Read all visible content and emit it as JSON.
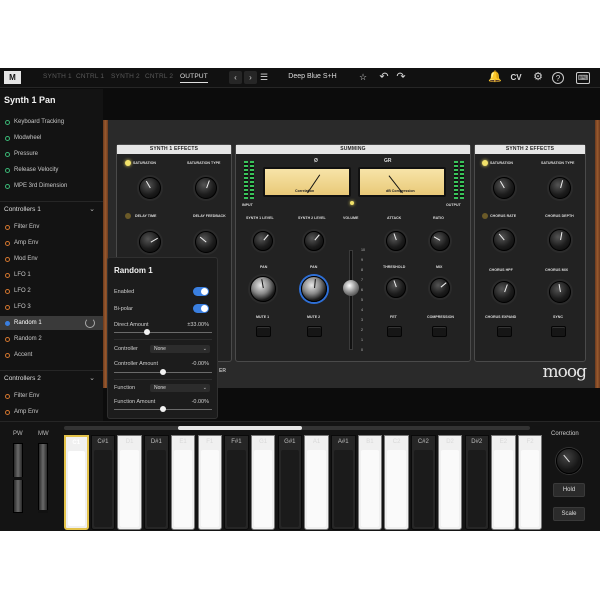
{
  "topbar": {
    "logo": "M",
    "tabs": [
      {
        "label": "SYNTH 1",
        "active": false
      },
      {
        "label": "CNTRL 1",
        "active": false
      },
      {
        "label": "SYNTH 2",
        "active": false
      },
      {
        "label": "CNTRL 2",
        "active": false
      },
      {
        "label": "OUTPUT",
        "active": true
      }
    ],
    "preset_name": "Deep Blue S+H",
    "icons": [
      "chevron-left-icon",
      "chevron-right-icon",
      "list-icon",
      "star-icon",
      "undo-icon",
      "redo-icon",
      "bell-icon",
      "cv-icon",
      "gear-icon",
      "help-icon",
      "keyboard-icon"
    ],
    "cv_label": "CV",
    "help_label": "?"
  },
  "sidebar": {
    "title": "Synth 1 Pan",
    "items": [
      {
        "label": "Keyboard Tracking",
        "color": "green"
      },
      {
        "label": "Modwheel",
        "color": "green"
      },
      {
        "label": "Pressure",
        "color": "green"
      },
      {
        "label": "Release Velocity",
        "color": "green"
      },
      {
        "label": "MPE 3rd Dimension",
        "color": "green"
      }
    ],
    "section1": "Controllers 1",
    "controllers1": [
      {
        "label": "Filter Env"
      },
      {
        "label": "Amp Env"
      },
      {
        "label": "Mod Env"
      },
      {
        "label": "LFO 1"
      },
      {
        "label": "LFO 2"
      },
      {
        "label": "LFO 3"
      },
      {
        "label": "Random 1",
        "active": true
      },
      {
        "label": "Random 2"
      },
      {
        "label": "Accent"
      }
    ],
    "section2": "Controllers 2",
    "controllers2": [
      {
        "label": "Filter Env"
      },
      {
        "label": "Amp Env"
      }
    ]
  },
  "synth": {
    "synth1_effects": {
      "title": "SYNTH 1 EFFECTS",
      "saturation": "SATURATION",
      "saturation_type": "SATURATION TYPE",
      "delay_time": "DELAY TIME",
      "delay_feedback": "DELAY FEEDBACK"
    },
    "summing": {
      "title": "SUMMING",
      "vu_left_label": "Correlation",
      "vu_right_label": "dB Compression",
      "gr_label": "GR",
      "input": "INPUT",
      "output": "OUTPUT",
      "synth1_level": "SYNTH 1 LEVEL",
      "synth2_level": "SYNTH 2 LEVEL",
      "volume": "VOLUME",
      "attack": "ATTACK",
      "ratio": "RATIO",
      "pan": "PAN",
      "threshold": "THRESHOLD",
      "mix": "MIX",
      "mute1": "MUTE 1",
      "mute2": "MUTE 2",
      "fet": "FET",
      "compression": "COMPRESSION",
      "scale": [
        "10",
        "9",
        "8",
        "7",
        "6",
        "5",
        "4",
        "3",
        "2",
        "1",
        "0"
      ]
    },
    "synth2_effects": {
      "title": "SYNTH 2 EFFECTS",
      "saturation": "SATURATION",
      "saturation_type": "SATURATION TYPE",
      "chorus_rate": "CHORUS RATE",
      "chorus_depth": "CHORUS DEPTH",
      "chorus_hpf": "CHORUS HPF",
      "chorus_mix": "CHORUS MIX",
      "chorus_expand": "CHORUS EXPAND",
      "sync": "SYNC"
    },
    "brand": "moog",
    "partial_label": "ER"
  },
  "popup": {
    "title": "Random 1",
    "enabled_label": "Enabled",
    "enabled": true,
    "bipolar_label": "Bi-polar",
    "bipolar": true,
    "direct_amount_label": "Direct Amount",
    "direct_amount_value": "±33.00%",
    "direct_amount_fraction": 0.33,
    "controller_label": "Controller",
    "controller_value": "None",
    "controller_amount_label": "Controller Amount",
    "controller_amount_value": "-0.00%",
    "controller_amount_fraction": 0.5,
    "function_label": "Function",
    "function_value": "None",
    "function_amount_label": "Function Amount",
    "function_amount_value": "-0.00%",
    "function_amount_fraction": 0.5
  },
  "keyboard": {
    "pw_label": "PW",
    "mw_label": "MW",
    "keys": [
      {
        "label": "C1",
        "type": "white"
      },
      {
        "label": "C#1",
        "type": "dark"
      },
      {
        "label": "D1",
        "type": "white"
      },
      {
        "label": "D#1",
        "type": "dark"
      },
      {
        "label": "E1",
        "type": "white"
      },
      {
        "label": "F1",
        "type": "white"
      },
      {
        "label": "F#1",
        "type": "dark"
      },
      {
        "label": "G1",
        "type": "white"
      },
      {
        "label": "G#1",
        "type": "dark"
      },
      {
        "label": "A1",
        "type": "white"
      },
      {
        "label": "A#1",
        "type": "dark"
      },
      {
        "label": "B1",
        "type": "white"
      },
      {
        "label": "C2",
        "type": "white"
      },
      {
        "label": "C#2",
        "type": "dark"
      },
      {
        "label": "D2",
        "type": "white"
      },
      {
        "label": "D#2",
        "type": "dark"
      },
      {
        "label": "E2",
        "type": "white"
      },
      {
        "label": "F2",
        "type": "white"
      }
    ],
    "correction_label": "Correction",
    "hold_label": "Hold",
    "scale_label": "Scale"
  }
}
